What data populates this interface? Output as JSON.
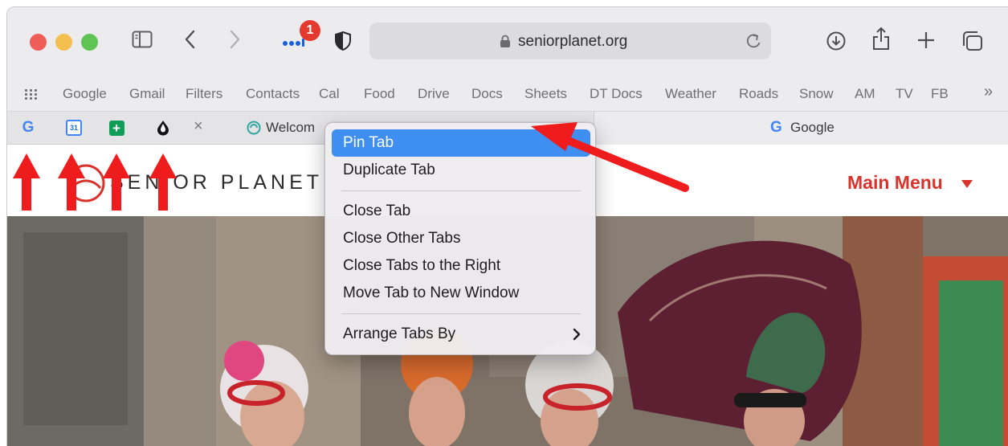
{
  "toolbar": {
    "extension_badge_count": "1",
    "address_bar": {
      "url": "seniorplanet.org"
    }
  },
  "favorites": [
    {
      "label": "Google"
    },
    {
      "label": "Gmail"
    },
    {
      "label": "Filters"
    },
    {
      "label": "Contacts"
    },
    {
      "label": "Cal"
    },
    {
      "label": "Food"
    },
    {
      "label": "Drive"
    },
    {
      "label": "Docs"
    },
    {
      "label": "Sheets"
    },
    {
      "label": "DT Docs"
    },
    {
      "label": "Weather"
    },
    {
      "label": "Roads"
    },
    {
      "label": "Snow"
    },
    {
      "label": "AM"
    },
    {
      "label": "TV"
    },
    {
      "label": "FB"
    }
  ],
  "favorites_more": "»",
  "tabs": {
    "pinned": [
      {
        "icon": "google-favicon",
        "glyph": "G",
        "color": "#4285f4"
      },
      {
        "icon": "google-calendar-favicon",
        "glyph": "31",
        "color": "#4285f4"
      },
      {
        "icon": "google-sheets-favicon",
        "glyph": "+",
        "color": "#0f9d58"
      },
      {
        "icon": "black-drop-favicon",
        "glyph": "♦",
        "color": "#111111"
      }
    ],
    "active_title": "Welcom",
    "other_title": "Google"
  },
  "page": {
    "logo_text": "SEN OR PLANET",
    "main_menu_label": "Main Menu",
    "brand_color": "#d9342b"
  },
  "context_menu": {
    "items": [
      {
        "label": "Pin Tab",
        "highlighted": true
      },
      {
        "label": "Duplicate Tab"
      },
      {
        "label": "Close Tab"
      },
      {
        "label": "Close Other Tabs"
      },
      {
        "label": "Close Tabs to the Right"
      },
      {
        "label": "Move Tab to New Window"
      },
      {
        "label": "Arrange Tabs By",
        "has_submenu": true
      }
    ],
    "highlight_color": "#3f8ff3"
  },
  "annotations": {
    "color": "#ee1c1c",
    "arrow_count": 5
  }
}
